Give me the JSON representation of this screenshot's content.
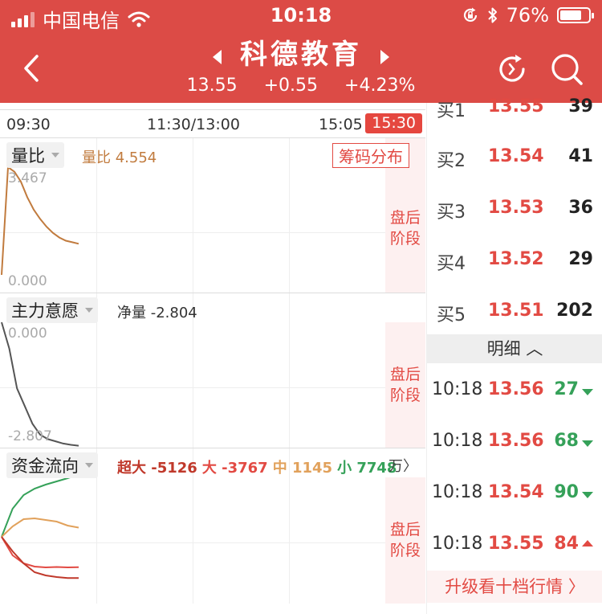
{
  "colors": {
    "header_bg": "#dc4b46",
    "up": "#e24a43",
    "down": "#35a159",
    "ratio_line": "#c17b3e"
  },
  "status": {
    "carrier": "中国电信",
    "time": "10:18",
    "battery": "76%",
    "battery_level": 0.76
  },
  "header": {
    "title": "科德教育",
    "price": "13.55",
    "change": "+0.55",
    "percent": "+4.23%"
  },
  "icons": {
    "back": "chevron-left-icon",
    "refresh": "refresh-icon",
    "search": "search-icon"
  },
  "timebar": {
    "open": "09:30",
    "mid": "11:30/13:00",
    "pre_close": "15:05 -",
    "close": "15:30"
  },
  "after_hours": [
    "盘后",
    "阶段"
  ],
  "volume_ratio": {
    "tab": "量比",
    "label": "量比 4.554",
    "chip": "筹码分布",
    "max": "3.467",
    "min": "0.000",
    "series": [
      0.0,
      3.467,
      3.32,
      3.0,
      2.5,
      2.1,
      1.8,
      1.55,
      1.35,
      1.2,
      1.1,
      1.05,
      1.0
    ]
  },
  "intent": {
    "tab": "主力意愿",
    "label": "净量 -2.804",
    "max": "0.000",
    "min": "-2.807",
    "series": [
      0.0,
      -0.6,
      -1.5,
      -1.9,
      -2.3,
      -2.55,
      -2.65,
      -2.7,
      -2.75,
      -2.78,
      -2.8
    ]
  },
  "fund_flow": {
    "tab": "资金流向",
    "unit": "万",
    "legend": [
      {
        "name": "超大",
        "value": "-5126",
        "color": "#c0392b"
      },
      {
        "name": "大",
        "value": "-3767",
        "color": "#e24a43"
      },
      {
        "name": "中",
        "value": "1145",
        "color": "#e1a15b"
      },
      {
        "name": "小",
        "value": "7748",
        "color": "#35a159"
      }
    ],
    "series": {
      "small": [
        0,
        3500,
        5200,
        6000,
        6500,
        6900,
        7300,
        7748
      ],
      "mid": [
        0,
        1300,
        2200,
        2300,
        2100,
        1900,
        1400,
        1145
      ],
      "large": [
        0,
        -2300,
        -3300,
        -3700,
        -3800,
        -3750,
        -3800,
        -3767
      ],
      "super": [
        0,
        -1800,
        -3300,
        -4400,
        -4800,
        -5000,
        -5126,
        -5126
      ]
    }
  },
  "bids": [
    {
      "label": "买1",
      "price": "13.55",
      "vol": "39"
    },
    {
      "label": "买2",
      "price": "13.54",
      "vol": "41"
    },
    {
      "label": "买3",
      "price": "13.53",
      "vol": "36"
    },
    {
      "label": "买4",
      "price": "13.52",
      "vol": "29"
    },
    {
      "label": "买5",
      "price": "13.51",
      "vol": "202"
    }
  ],
  "detail_header": "明细",
  "ticks": [
    {
      "time": "10:18",
      "price": "13.56",
      "vol": "27",
      "dir": "down"
    },
    {
      "time": "10:18",
      "price": "13.56",
      "vol": "68",
      "dir": "down"
    },
    {
      "time": "10:18",
      "price": "13.54",
      "vol": "90",
      "dir": "down"
    },
    {
      "time": "10:18",
      "price": "13.55",
      "vol": "84",
      "dir": "up"
    }
  ],
  "upgrade": "升级看十档行情 〉"
}
